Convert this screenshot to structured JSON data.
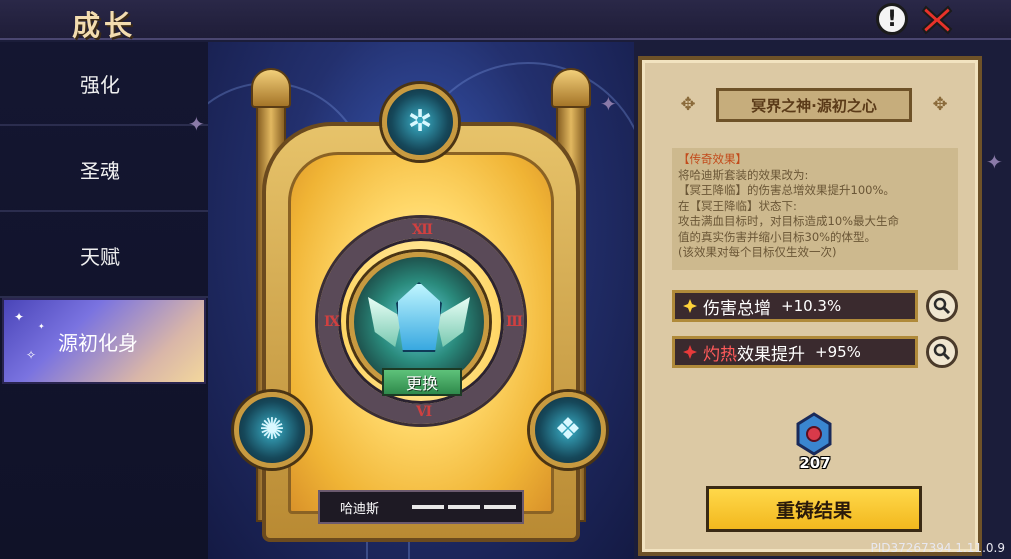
{
  "header": {
    "title": "成长",
    "info_icon": "exclamation-circle-icon",
    "close_icon": "red-x-icon"
  },
  "sidebar": {
    "tabs": [
      {
        "label": "强化",
        "active": false
      },
      {
        "label": "圣魂",
        "active": false
      },
      {
        "label": "天赋",
        "active": false
      },
      {
        "label": "源初化身",
        "active": true
      }
    ]
  },
  "stage": {
    "numerals": {
      "top": "Ⅻ",
      "left": "Ⅸ",
      "right": "Ⅲ",
      "bottom": "Ⅵ"
    },
    "swap_label": "更换",
    "hero_name": "哈迪斯",
    "pips_count": 3
  },
  "panel": {
    "title": "冥界之神·源初之心",
    "effect": {
      "title": "【传奇效果】",
      "lines": [
        "将哈迪斯套装的效果改为:",
        "【冥王降临】的伤害总增效果提升100%。",
        "在【冥王降临】状态下:",
        "攻击满血目标时，对目标造成10%最大生命",
        "值的真实伤害并缩小目标30%的体型。",
        "(该效果对每个目标仅生效一次)"
      ]
    },
    "stats": [
      {
        "icon": "yellow-burst-icon",
        "label": "伤害总增",
        "label_highlight": "",
        "value": "+10.3%"
      },
      {
        "icon": "red-burst-icon",
        "label": "效果提升",
        "label_highlight": "灼热",
        "value": "+95%"
      }
    ],
    "zoom_icon": "magnifier-icon",
    "item": {
      "icon": "blue-red-gem-icon",
      "count": "207"
    },
    "recast_label": "重铸结果"
  },
  "footer": {
    "version": "PID37267394 1.11.0.9"
  },
  "colors": {
    "accent_gold": "#f2b81e",
    "panel_bg": "#dcc9a4",
    "active_tab": "#7a73e0",
    "swap_green": "#2f8a4c"
  }
}
